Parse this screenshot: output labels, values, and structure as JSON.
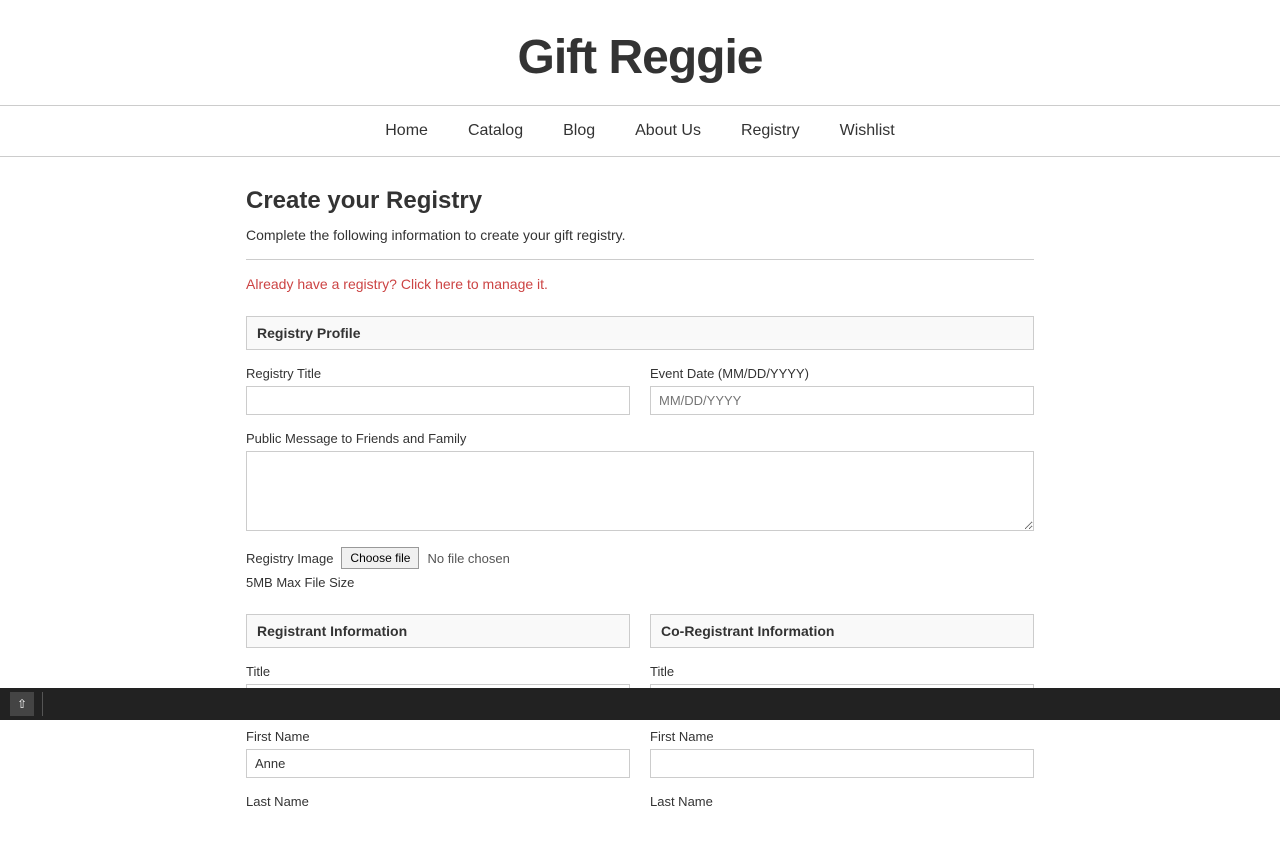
{
  "site": {
    "title": "Gift Reggie"
  },
  "nav": {
    "items": [
      {
        "label": "Home",
        "id": "home"
      },
      {
        "label": "Catalog",
        "id": "catalog"
      },
      {
        "label": "Blog",
        "id": "blog"
      },
      {
        "label": "About Us",
        "id": "about-us"
      },
      {
        "label": "Registry",
        "id": "registry"
      },
      {
        "label": "Wishlist",
        "id": "wishlist"
      }
    ]
  },
  "main": {
    "page_title": "Create your Registry",
    "page_description": "Complete the following information to create your gift registry.",
    "registry_link": "Already have a registry? Click here to manage it.",
    "registry_profile": {
      "section_label": "Registry Profile",
      "registry_title_label": "Registry Title",
      "registry_title_value": "",
      "event_date_label": "Event Date (MM/DD/YYYY)",
      "event_date_placeholder": "MM/DD/YYYY",
      "public_message_label": "Public Message to Friends and Family",
      "public_message_value": "",
      "registry_image_label": "Registry Image",
      "choose_file_label": "Choose file",
      "no_file_label": "No file chosen",
      "file_size_note": "5MB Max File Size"
    },
    "registrant": {
      "section_label": "Registrant Information",
      "title_label": "Title",
      "title_value": "",
      "first_name_label": "First Name",
      "first_name_value": "Anne",
      "last_name_label": "Last Name"
    },
    "co_registrant": {
      "section_label": "Co-Registrant Information",
      "title_label": "Title",
      "title_value": "",
      "first_name_label": "First Name",
      "first_name_value": "",
      "last_name_label": "Last Name"
    }
  }
}
